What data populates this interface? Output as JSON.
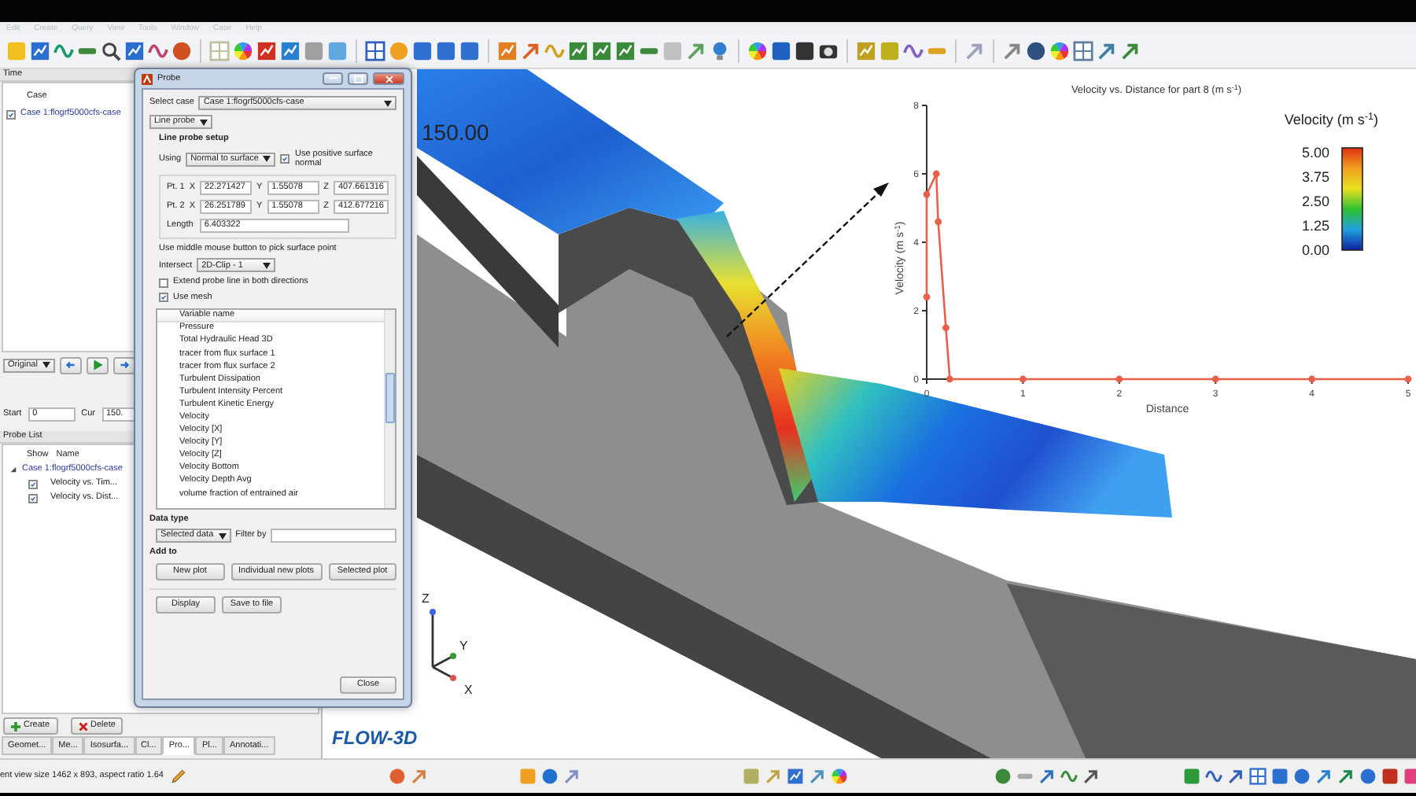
{
  "menu": [
    "Edit",
    "Create",
    "Query",
    "View",
    "Tools",
    "Window",
    "Case",
    "Help"
  ],
  "left_panel": {
    "header": "Time",
    "case_column": "Case",
    "cases": [
      {
        "label": "Case 1:flogrf5000cfs-case",
        "checked": true
      }
    ],
    "view_mode": "Original",
    "start_label": "Start",
    "start_value": "0",
    "cur_label": "Cur",
    "cur_value": "150.",
    "probe_list": {
      "header": "Probe List",
      "columns": [
        "Show",
        "Name"
      ],
      "tree": [
        {
          "label": "Case 1:flogrf5000cfs-case",
          "expanded": true,
          "children": [
            {
              "label": "Velocity vs. Tim...",
              "checked": true
            },
            {
              "label": "Velocity  vs. Dist...",
              "checked": true
            }
          ]
        }
      ]
    },
    "create_button": "Create",
    "delete_button": "Delete",
    "tabs": [
      {
        "label": "Geomet...",
        "selected": false
      },
      {
        "label": "Me...",
        "selected": false
      },
      {
        "label": "Isosurfa...",
        "selected": false
      },
      {
        "label": "Cl...",
        "selected": false
      },
      {
        "label": "Pro...",
        "selected": true
      },
      {
        "label": "Pl...",
        "selected": false
      },
      {
        "label": "Annotati...",
        "selected": false
      }
    ]
  },
  "probe_dialog": {
    "title": "Probe",
    "select_case_label": "Select case",
    "case": "Case 1:flogrf5000cfs-case",
    "probe_type": "Line probe",
    "setup_heading": "Line probe setup",
    "using_label": "Using",
    "using": "Normal to surface",
    "positive_normal": {
      "label": "Use positive surface normal",
      "checked": true
    },
    "points": [
      {
        "label": "Pt. 1",
        "coords": [
          {
            "axis": "X",
            "value": "22.271427"
          },
          {
            "axis": "Y",
            "value": "1.55078"
          },
          {
            "axis": "Z",
            "value": "407.661316"
          }
        ]
      },
      {
        "label": "Pt. 2",
        "coords": [
          {
            "axis": "X",
            "value": "26.251789"
          },
          {
            "axis": "Y",
            "value": "1.55078"
          },
          {
            "axis": "Z",
            "value": "412.677216"
          }
        ]
      }
    ],
    "length_label": "Length",
    "length": "6.403322",
    "hint": "Use middle mouse button to pick surface point",
    "intersect_label": "Intersect",
    "intersect": "2D-Clip - 1",
    "options": [
      {
        "label": "Extend probe line in both directions",
        "checked": false
      },
      {
        "label": "Use mesh",
        "checked": true
      }
    ],
    "variables": {
      "header": "Variable name",
      "items": [
        "Pressure",
        "Total Hydraulic Head 3D",
        "tracer from flux surface 1",
        "tracer from flux surface 2",
        "Turbulent Dissipation",
        "Turbulent Intensity Percent",
        "Turbulent Kinetic Energy",
        "Velocity",
        "Velocity [X]",
        "Velocity [Y]",
        "Velocity [Z]",
        "Velocity Bottom",
        "Velocity Depth Avg",
        "volume fraction of entrained air"
      ]
    },
    "data_type_heading": "Data type",
    "data_type": "Selected data",
    "filter_label": "Filter by",
    "add_to_heading": "Add to",
    "add_buttons": [
      "New plot",
      "Individual new plots",
      "Selected plot"
    ],
    "output_buttons": [
      "Display",
      "Save to file"
    ],
    "close_button": "Close"
  },
  "view": {
    "time": "150.00",
    "logo": "FLOW-3D",
    "axes": [
      "Z",
      "Y",
      "X"
    ],
    "chart": {
      "legend_title": "Velocity (m s$^{-1}$)",
      "legend_ticks": [
        "5.00",
        "3.75",
        "2.50",
        "1.25",
        "0.00"
      ],
      "chart_data": {
        "type": "line",
        "title": "Velocity  vs. Distance for part 8 (m s$^{-1}$)",
        "xlabel": "Distance",
        "ylabel": "Velocity  (m s$^{-1}$)",
        "x": [
          0,
          0,
          0.1,
          0.12,
          0.2,
          0.24,
          1,
          2,
          3,
          4,
          5
        ],
        "series": [
          {
            "color": "#e8604a",
            "marker": true,
            "values": [
              2.4,
              5.4,
              6,
              4.6,
              1.5,
              0,
              0,
              0,
              0,
              0,
              0
            ]
          }
        ],
        "xlim": [
          0,
          5
        ],
        "ylim": [
          0,
          8
        ],
        "xticks": [
          0,
          1,
          2,
          3,
          4,
          5
        ],
        "yticks": [
          0,
          2,
          4,
          6,
          8
        ]
      }
    }
  },
  "status_bar": {
    "text": "ent view size 1462 x 893, aspect ratio 1.64"
  }
}
